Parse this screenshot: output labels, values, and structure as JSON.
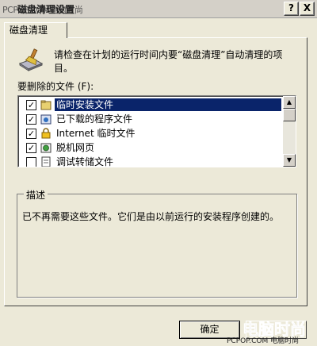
{
  "window": {
    "watermark_text": "PCPOP.COM电脑时尚",
    "title": "磁盘清理设置",
    "help_label": "?",
    "close_label": "X"
  },
  "tab": {
    "label": "磁盘清理"
  },
  "intro": {
    "text": "请检查在计划的运行时间内要“磁盘清理”自动清理的项目。"
  },
  "files": {
    "label": "要删除的文件 (F):",
    "items": [
      {
        "label": "临时安装文件",
        "checked": true,
        "icon": "folder-icon"
      },
      {
        "label": "已下载的程序文件",
        "checked": true,
        "icon": "downloaded-program-icon"
      },
      {
        "label": "Internet 临时文件",
        "checked": true,
        "icon": "lock-icon"
      },
      {
        "label": "脱机网页",
        "checked": true,
        "icon": "offline-page-icon"
      },
      {
        "label": "调试转储文件",
        "checked": false,
        "icon": "document-icon"
      }
    ]
  },
  "description": {
    "title": "描述",
    "text": "已不再需要这些文件。它们是由以前运行的安装程序创建的。"
  },
  "buttons": {
    "ok_label": "确定"
  },
  "watermark": {
    "url": "PCPOP.COM 电脑时尚"
  }
}
